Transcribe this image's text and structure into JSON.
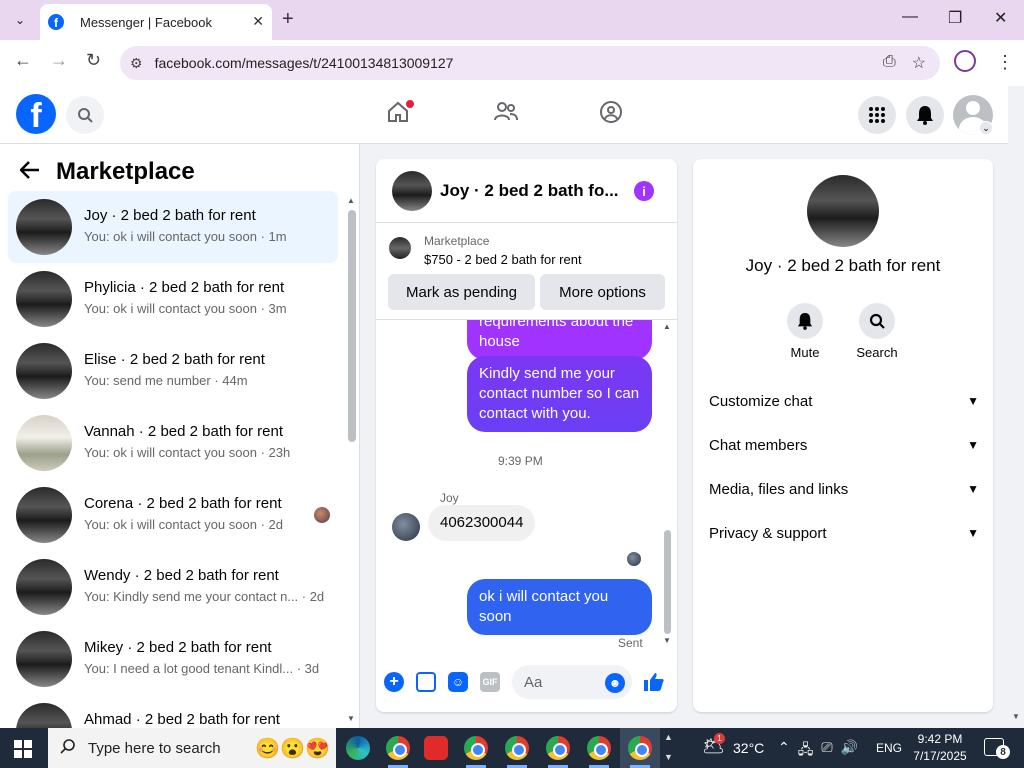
{
  "browser": {
    "tab_title": "Messenger | Facebook",
    "url": "facebook.com/messages/t/24100134813009127",
    "icons": [
      "tab-search-icon",
      "close-icon",
      "plus-icon",
      "minimize-icon",
      "maximize-icon",
      "close-window-icon",
      "back-icon",
      "forward-icon",
      "reload-icon",
      "site-info-icon",
      "install-app-icon",
      "star-icon",
      "profile-icon",
      "kebab-icon"
    ]
  },
  "fb_header": {
    "nav_icons": [
      "home-icon",
      "friends-icon",
      "groups-icon"
    ],
    "right_icons": [
      "menu-grid-icon",
      "notifications-bell-icon",
      "account-avatar"
    ]
  },
  "sidebar": {
    "title": "Marketplace",
    "conversations": [
      {
        "name": "Joy · 2 bed 2 bath for rent",
        "preview": "You: ok i will contact you soon · 1m"
      },
      {
        "name": "Phylicia · 2 bed 2 bath for rent",
        "preview": "You: ok i will contact you soon · 3m"
      },
      {
        "name": "Elise · 2 bed 2 bath for rent",
        "preview": "You: send me number · 44m"
      },
      {
        "name": "Vannah · 2 bed 2 bath for rent",
        "preview": "You: ok i will contact you soon · 23h"
      },
      {
        "name": "Corena · 2 bed 2 bath for rent",
        "preview": "You: ok i will contact you soon · 2d"
      },
      {
        "name": "Wendy · 2 bed 2 bath for rent",
        "preview": "You: Kindly send me your contact n... · 2d"
      },
      {
        "name": "Mikey · 2 bed 2 bath for rent",
        "preview": "You: I need a lot good tenant Kindl... · 3d"
      },
      {
        "name": "Ahmad · 2 bed 2 bath for rent",
        "preview": ""
      }
    ]
  },
  "chat": {
    "title": "Joy · 2 bed 2 bath fo...",
    "marketplace_label": "Marketplace",
    "listing": "$750 - 2 bed 2 bath for rent",
    "mark_pending": "Mark as pending",
    "more_options": "More options",
    "messages": {
      "m1": "requirements about the house",
      "m2": "Kindly send me your contact number so I can contact with you.",
      "timestamp": "9:39 PM",
      "sender": "Joy",
      "m3": "4062300044",
      "m4": "ok i will contact you soon",
      "status": "Sent"
    },
    "composer_placeholder": "Aa"
  },
  "info_panel": {
    "name": "Joy · 2 bed 2 bath for rent",
    "mute": "Mute",
    "search": "Search",
    "sections": [
      "Customize chat",
      "Chat members",
      "Media, files and links",
      "Privacy & support"
    ]
  },
  "taskbar": {
    "search_placeholder": "Type here to search",
    "weather": "32°C",
    "weather_badge": "1",
    "lang": "ENG",
    "time": "9:42 PM",
    "date": "7/17/2025",
    "notifications": "8"
  },
  "colors": {
    "fb_blue": "#0866ff",
    "messenger_purple": "#a033ff",
    "sent_blue": "#2f63f0",
    "active_conv_bg": "#ebf5ff"
  }
}
